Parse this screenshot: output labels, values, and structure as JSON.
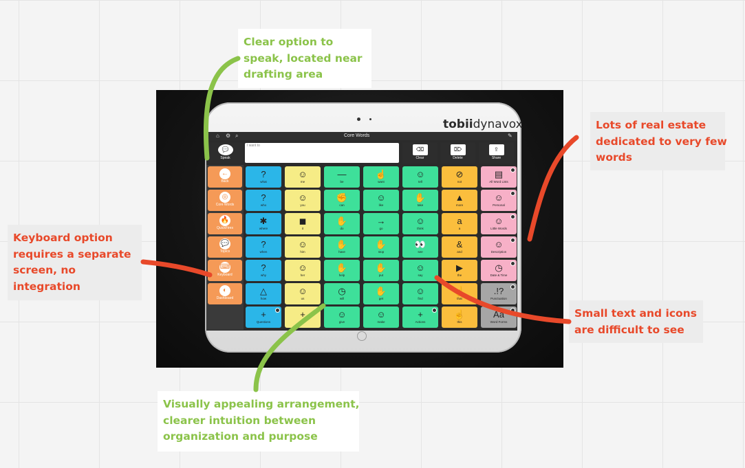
{
  "annotations": {
    "speak_note": [
      "Clear option to",
      "speak, located near",
      "drafting area"
    ],
    "real_estate_note": [
      "Lots of real estate",
      "dedicated to very few",
      "words"
    ],
    "keyboard_note": [
      "Keyboard option",
      "requires a separate",
      "screen, no",
      "integration"
    ],
    "small_text_note": [
      "Small text and icons",
      "are difficult to see"
    ],
    "visual_note": [
      "Visually appealing arrangement,",
      "clearer intuition between",
      "organization and purpose"
    ]
  },
  "colors": {
    "green_note": "#8bc34a",
    "red_note": "#e8492a"
  },
  "app": {
    "brand_bold": "tobii",
    "brand_rest": "dynavox",
    "page_title": "Core Words",
    "draft_placeholder": "I want to",
    "toolbar": {
      "speak": "Speak",
      "clear": "Clear",
      "delete": "Delete",
      "share": "Share"
    },
    "left_buttons": [
      "Back",
      "Core Words",
      "QuickFires",
      "Topics",
      "Keyboard",
      "Dashboard"
    ],
    "grid": [
      [
        "what",
        "me",
        "be",
        "want",
        "tell",
        "not",
        "All Word Lists"
      ],
      [
        "who",
        "you",
        "can",
        "like",
        "take",
        "more",
        "Personal"
      ],
      [
        "where",
        "it",
        "do",
        "go",
        "think",
        "a",
        "Little Words"
      ],
      [
        "when",
        "him",
        "have",
        "stop",
        "see",
        "and",
        "Description"
      ],
      [
        "why",
        "her",
        "help",
        "put",
        "say",
        "the",
        "Date & Time"
      ],
      [
        "how",
        "us",
        "will",
        "get",
        "find",
        "that",
        "Punctuation"
      ],
      [
        "Questions",
        "",
        "give",
        "make",
        "Actions",
        "this",
        "Word Forms"
      ]
    ]
  }
}
